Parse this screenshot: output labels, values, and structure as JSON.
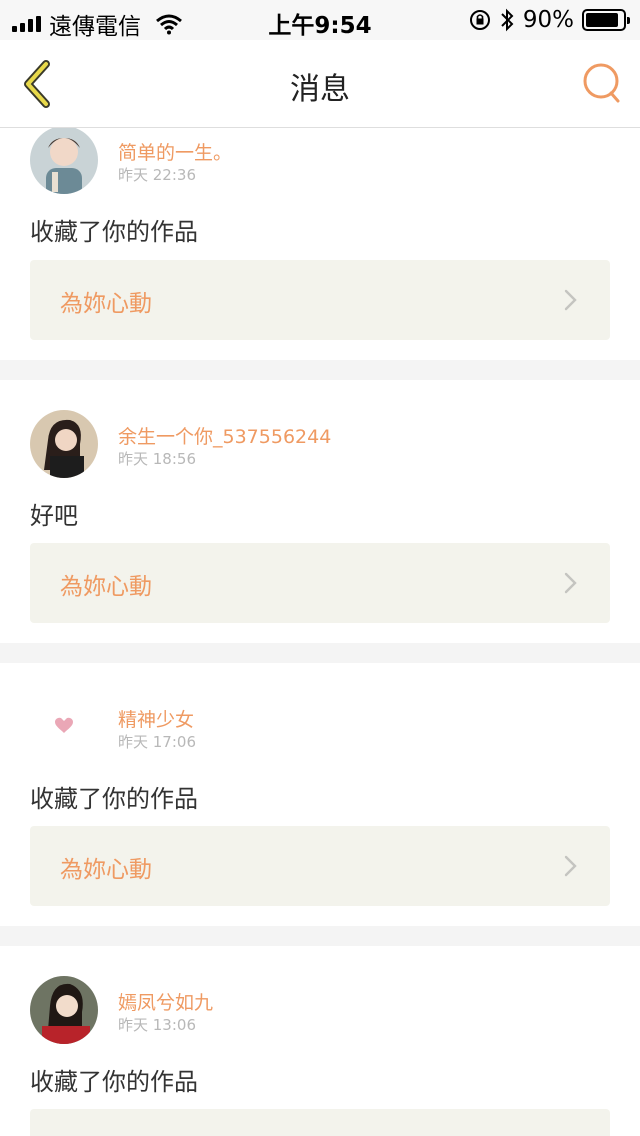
{
  "status_bar": {
    "carrier": "遠傳電信",
    "time": "上午9:54",
    "battery_percent": "90%",
    "battery_level": 0.9
  },
  "nav": {
    "title": "消息",
    "back_icon": "chevron-left-icon",
    "search_icon": "search-icon"
  },
  "colors": {
    "accent": "#ef9a62",
    "back_icon_color": "#e8d94a",
    "card_link_bg": "#f3f3ec",
    "page_bg": "#f4f4f4"
  },
  "messages": [
    {
      "username": "简单的一生。",
      "time": "昨天 22:36",
      "text": "收藏了你的作品",
      "work_title": "為妳心動"
    },
    {
      "username": "余生一个你_537556244",
      "time": "昨天 18:56",
      "text": "好吧",
      "work_title": "為妳心動"
    },
    {
      "username": "精神少女",
      "time": "昨天 17:06",
      "text": "收藏了你的作品",
      "work_title": "為妳心動"
    },
    {
      "username": "嫣凤兮如九",
      "time": "昨天 13:06",
      "text": "收藏了你的作品",
      "work_title": ""
    }
  ]
}
